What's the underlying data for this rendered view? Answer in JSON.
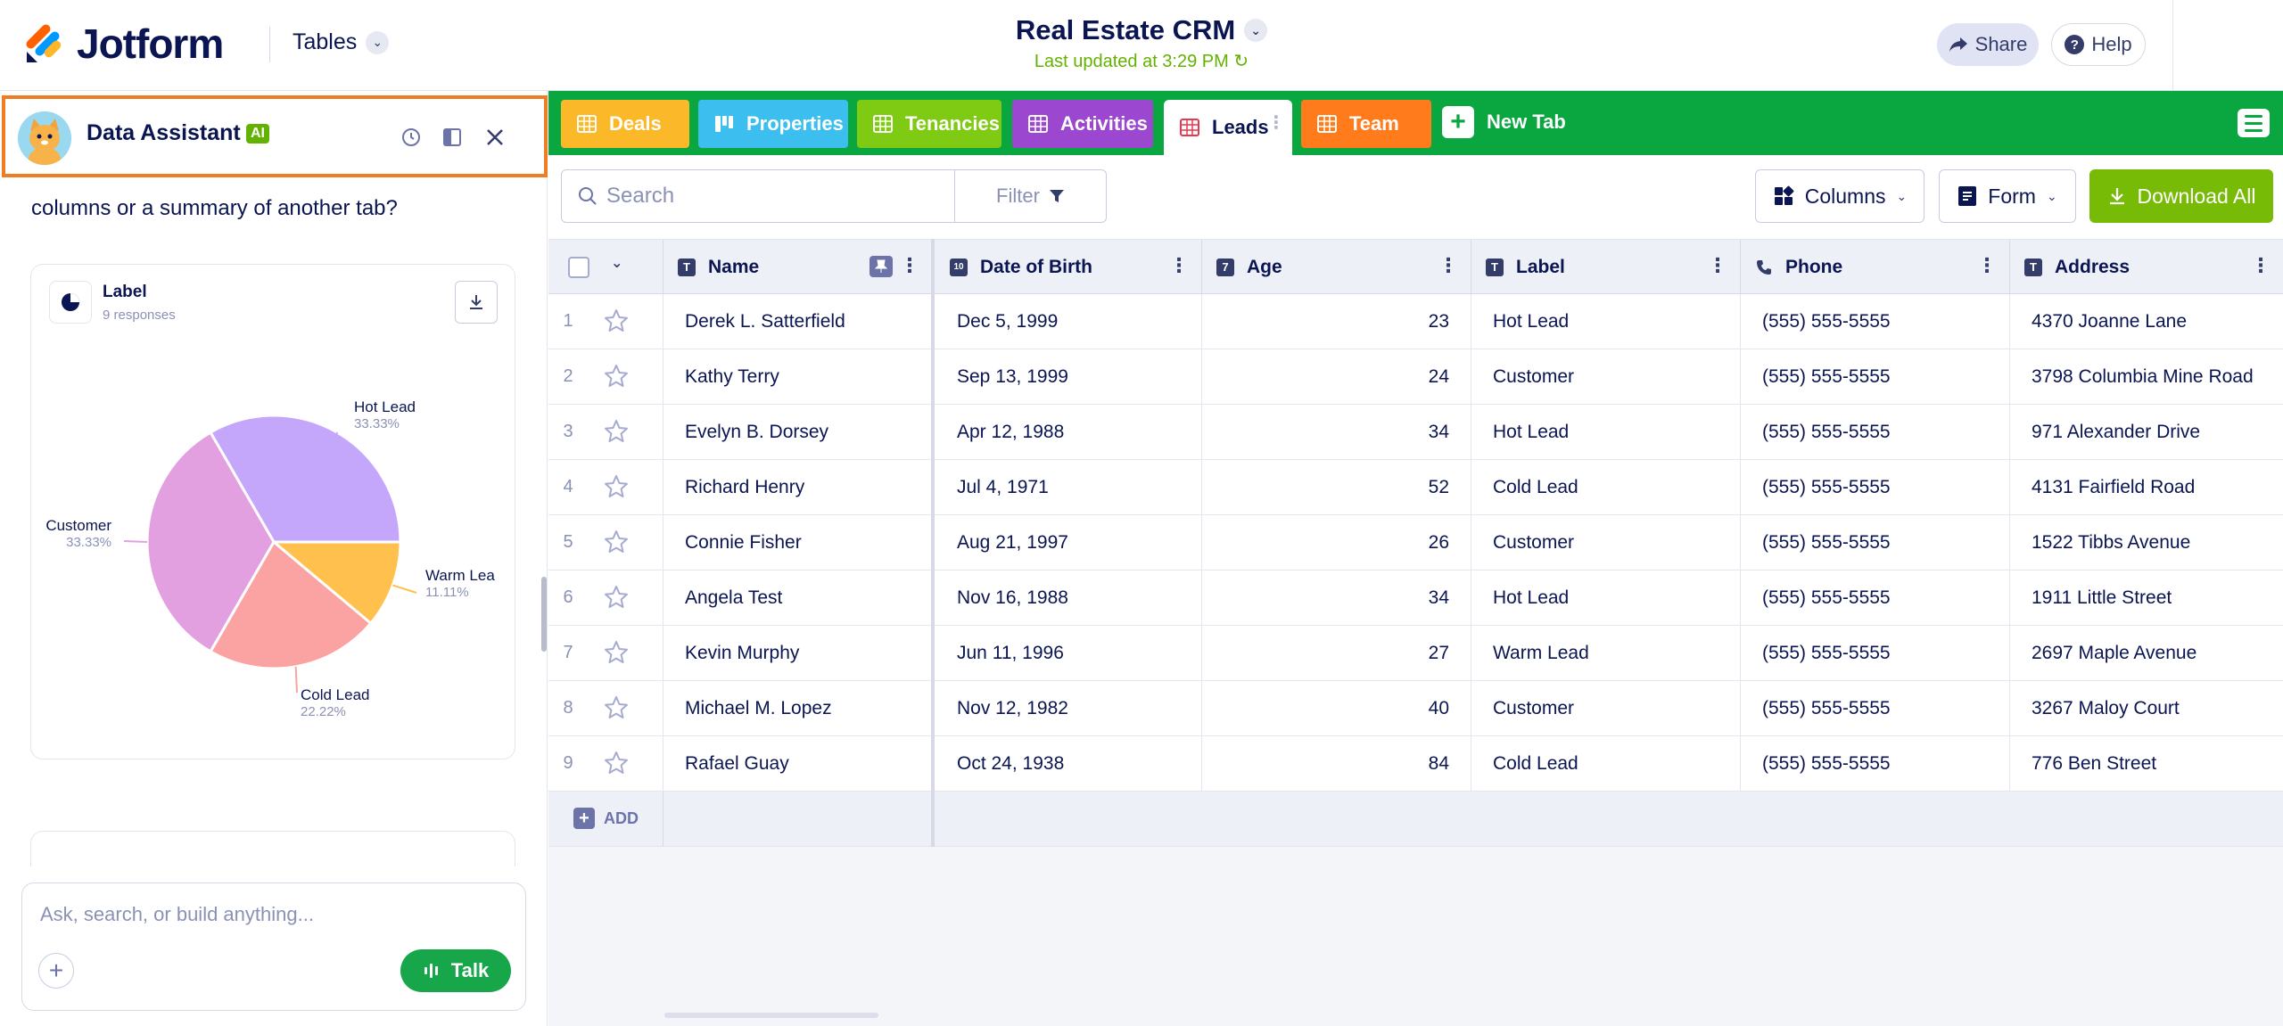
{
  "topbar": {
    "brand": "Jotform",
    "tables_label": "Tables",
    "app_title": "Real Estate CRM",
    "last_updated": "Last updated at 3:29 PM",
    "share_label": "Share",
    "help_label": "Help"
  },
  "assistant": {
    "name": "Data Assistant",
    "badge": "AI",
    "question": "columns or a summary of another tab?",
    "chart_title": "Label",
    "chart_responses": "9 responses",
    "input_placeholder": "Ask, search, or build anything...",
    "talk_label": "Talk"
  },
  "chart_data": {
    "type": "pie",
    "title": "Label",
    "slices": [
      {
        "label": "Hot Lead",
        "pct_label": "33.33%",
        "value": 3,
        "color": "#c4a7fb"
      },
      {
        "label": "Warm Lea",
        "pct_label": "11.11%",
        "value": 1,
        "color": "#ffc04d"
      },
      {
        "label": "Cold Lead",
        "pct_label": "22.22%",
        "value": 2,
        "color": "#fba3a3"
      },
      {
        "label": "Customer",
        "pct_label": "33.33%",
        "value": 3,
        "color": "#e3a0e0"
      }
    ]
  },
  "tabs": [
    {
      "label": "Deals",
      "color": "#fbb929"
    },
    {
      "label": "Properties",
      "color": "#3cbeee"
    },
    {
      "label": "Tenancies",
      "color": "#7fca12"
    },
    {
      "label": "Activities",
      "color": "#9b47d0"
    },
    {
      "label": "Leads",
      "color": "#e5394f",
      "active": true
    },
    {
      "label": "Team",
      "color": "#ff7b1c"
    }
  ],
  "new_tab_label": "New Tab",
  "toolbar": {
    "search_placeholder": "Search",
    "filter_label": "Filter",
    "columns_label": "Columns",
    "form_label": "Form",
    "download_label": "Download All"
  },
  "columns": [
    "Name",
    "Date of Birth",
    "Age",
    "Label",
    "Phone",
    "Address"
  ],
  "rows": [
    {
      "n": "1",
      "name": "Derek L. Satterfield",
      "dob": "Dec 5, 1999",
      "age": "23",
      "label": "Hot Lead",
      "phone": "(555) 555-5555",
      "address": "4370 Joanne Lane"
    },
    {
      "n": "2",
      "name": "Kathy Terry",
      "dob": "Sep 13, 1999",
      "age": "24",
      "label": "Customer",
      "phone": "(555) 555-5555",
      "address": "3798 Columbia Mine Road"
    },
    {
      "n": "3",
      "name": "Evelyn B. Dorsey",
      "dob": "Apr 12, 1988",
      "age": "34",
      "label": "Hot Lead",
      "phone": "(555) 555-5555",
      "address": "971 Alexander Drive"
    },
    {
      "n": "4",
      "name": "Richard Henry",
      "dob": "Jul 4, 1971",
      "age": "52",
      "label": "Cold Lead",
      "phone": "(555) 555-5555",
      "address": "4131 Fairfield Road"
    },
    {
      "n": "5",
      "name": "Connie Fisher",
      "dob": "Aug 21, 1997",
      "age": "26",
      "label": "Customer",
      "phone": "(555) 555-5555",
      "address": "1522 Tibbs Avenue"
    },
    {
      "n": "6",
      "name": "Angela Test",
      "dob": "Nov 16, 1988",
      "age": "34",
      "label": "Hot Lead",
      "phone": "(555) 555-5555",
      "address": "1911 Little Street"
    },
    {
      "n": "7",
      "name": "Kevin Murphy",
      "dob": "Jun 11, 1996",
      "age": "27",
      "label": "Warm Lead",
      "phone": "(555) 555-5555",
      "address": "2697 Maple Avenue"
    },
    {
      "n": "8",
      "name": "Michael M. Lopez",
      "dob": "Nov 12, 1982",
      "age": "40",
      "label": "Customer",
      "phone": "(555) 555-5555",
      "address": "3267 Maloy Court"
    },
    {
      "n": "9",
      "name": "Rafael Guay",
      "dob": "Oct 24, 1938",
      "age": "84",
      "label": "Cold Lead",
      "phone": "(555) 555-5555",
      "address": "776 Ben Street"
    }
  ],
  "add_row_label": "ADD"
}
